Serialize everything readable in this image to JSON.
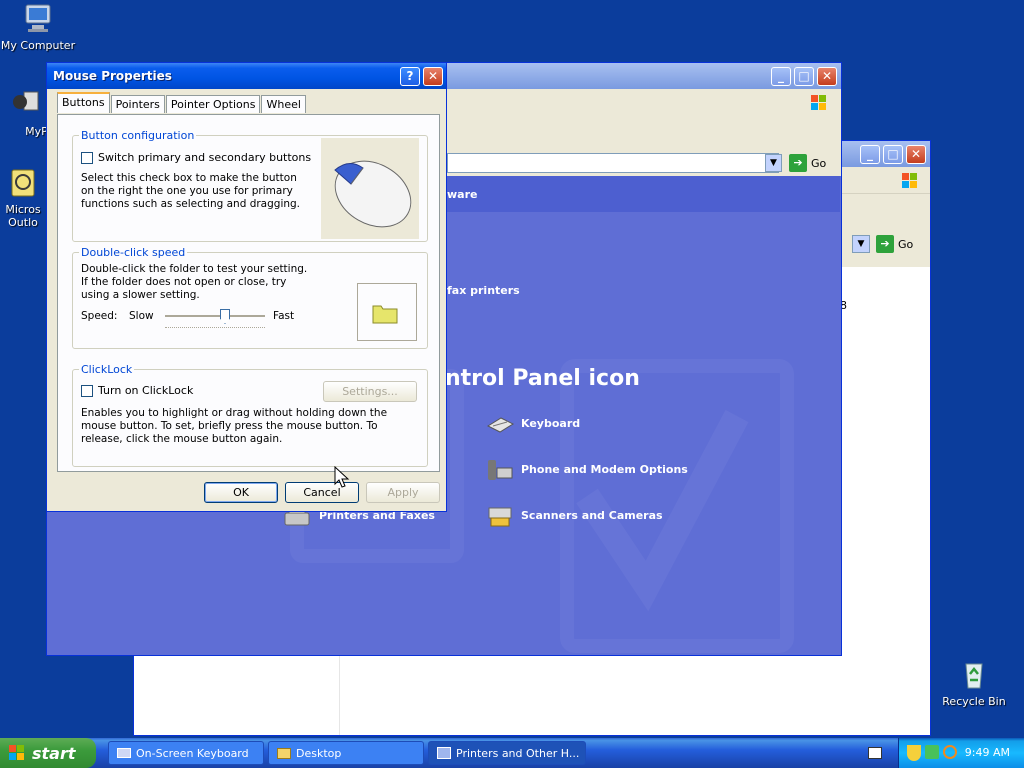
{
  "desktop": {
    "icons": [
      {
        "label": "My Computer"
      },
      {
        "label": "MyPa"
      },
      {
        "label": "Micros Outlo"
      },
      {
        "label": "Recycle Bin"
      }
    ]
  },
  "back_window": {
    "go_label": "Go"
  },
  "front_window": {
    "go_label": "Go",
    "task_header": "ware",
    "task_link": "fax printers",
    "panel_heading": "ntrol Panel icon",
    "items": [
      {
        "label": "Keyboard"
      },
      {
        "label": "Phone and Modem Options"
      },
      {
        "label": "Printers and Faxes"
      },
      {
        "label": "Scanners and Cameras"
      }
    ],
    "right_text_1": "8"
  },
  "dialog": {
    "title": "Mouse Properties",
    "tabs": [
      "Buttons",
      "Pointers",
      "Pointer Options",
      "Wheel"
    ],
    "active_tab": "Buttons",
    "button_config": {
      "title": "Button configuration",
      "checkbox_label": "Switch primary and secondary buttons",
      "checked": false,
      "description": "Select this check box to make the button on the right the one you use for primary functions such as selecting and dragging."
    },
    "double_click": {
      "title": "Double-click speed",
      "description": "Double-click the folder to test your setting. If the folder does not open or close, try using a slower setting.",
      "speed_label": "Speed:",
      "slow_label": "Slow",
      "fast_label": "Fast",
      "slider_value": 0.6
    },
    "clicklock": {
      "title": "ClickLock",
      "checkbox_label": "Turn on ClickLock",
      "checked": false,
      "settings_label": "Settings...",
      "description": "Enables you to highlight or drag without holding down the mouse button. To set, briefly press the mouse button. To release, click the mouse button again."
    },
    "ok_label": "OK",
    "cancel_label": "Cancel",
    "apply_label": "Apply"
  },
  "taskbar": {
    "start_label": "start",
    "tasks": [
      {
        "label": "On-Screen Keyboard"
      },
      {
        "label": "Desktop"
      },
      {
        "label": "Printers and Other H..."
      }
    ],
    "clock": "9:49 AM"
  },
  "colors": {
    "desktop_bg": "#0b3d9c",
    "panel_bg": "#5f6ed5",
    "title_blue": "#0054e3",
    "group_title": "#0046d5"
  }
}
